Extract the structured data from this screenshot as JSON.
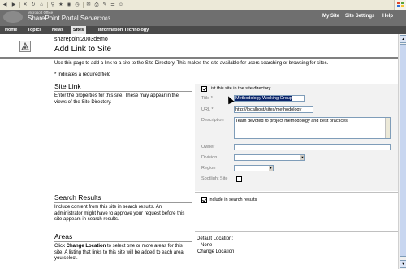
{
  "header": {
    "logo_small": "Microsoft Office",
    "logo_big": "SharePoint Portal Server",
    "logo_year": "2003",
    "links": [
      "My Site",
      "Site Settings",
      "Help"
    ]
  },
  "nav": {
    "items": [
      "Home",
      "Topics",
      "News",
      "Sites",
      "Information Technology"
    ],
    "active_index": 3
  },
  "page": {
    "site_name": "sharepoint2003demo",
    "title": "Add Link to Site",
    "intro": "Use this page to add a link to a site to the Site Directory. This makes the site available for users searching or browsing for sites.",
    "required_note": "* Indicates a required field"
  },
  "site_link": {
    "title": "Site Link",
    "desc": "Enter the properties for this site. These may appear in the views of the Site Directory.",
    "list_checkbox_label": "List this site in the site directory",
    "list_checked": true,
    "title_label": "Title *",
    "title_value": "Methodology Working Group",
    "url_label": "URL *",
    "url_value": "http://localhost/sites/methodology",
    "description_label": "Description",
    "description_value": "Team devoted to project methodology and best practices",
    "owner_label": "Owner",
    "division_label": "Division",
    "region_label": "Region",
    "spotlight_label": "Spotlight Site",
    "spotlight_checked": false
  },
  "search_results": {
    "title": "Search Results",
    "desc": "Include content from this site in search results. An administrator might have to approve your request before this site appears in search results.",
    "checkbox_label": "Include in search results",
    "checked": true
  },
  "areas": {
    "title": "Areas",
    "desc_prefix": "Click ",
    "desc_bold": "Change Location",
    "desc_suffix": " to select one or more areas for this site. A listing that links to this site will be added to each area you select.",
    "default_location_label": "Default Location:",
    "default_location_value": "None",
    "change_location_link": "Change Location"
  },
  "colors": {
    "header_bg": "#6f6f6f",
    "nav_bg": "#4a4a4a",
    "selection": "#0a246a"
  }
}
